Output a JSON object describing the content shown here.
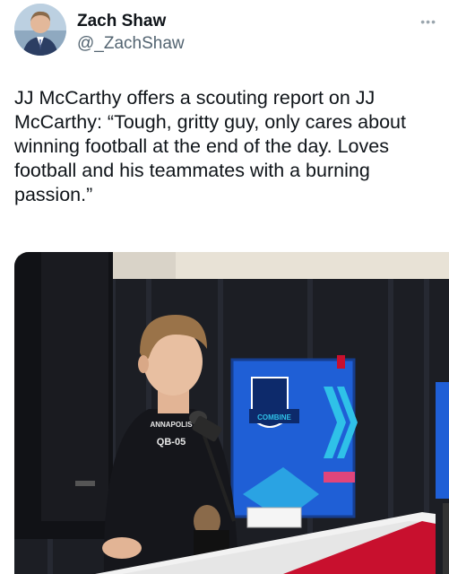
{
  "tweet": {
    "author_name": "Zach Shaw",
    "author_handle": "@_ZachShaw",
    "more_icon": "more-dots-icon",
    "text": "JJ McCarthy offers a scouting report on JJ McCarthy: “Tough, gritty guy, only cares about winning football at the end of the day. Loves football and his teammates with a burning passion.”"
  },
  "photo": {
    "shirt_text_top": "ANNAPOLIS",
    "shirt_text_bottom": "QB-05",
    "banner_text": "COMBINE",
    "brand_colors": {
      "backdrop": "#1f5fd6",
      "stripe": "#2fc1e8",
      "podium": "#c8102e"
    }
  }
}
